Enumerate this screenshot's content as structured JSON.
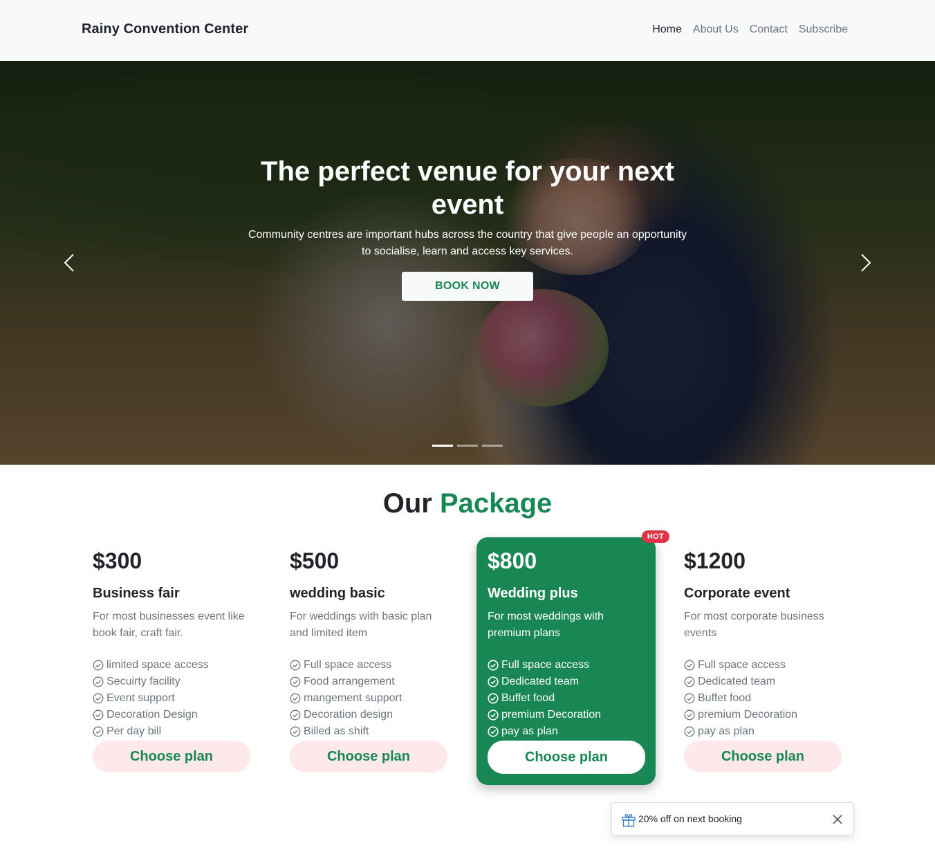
{
  "navbar": {
    "brand": "Rainy Convention Center",
    "links": [
      {
        "label": "Home",
        "active": true
      },
      {
        "label": "About Us",
        "active": false
      },
      {
        "label": "Contact",
        "active": false
      },
      {
        "label": "Subscribe",
        "active": false
      }
    ]
  },
  "hero": {
    "title": "The perfect venue for your next event",
    "text": "Community centres are important hubs across the country that give people an opportunity to socialise, learn and access key services.",
    "cta_label": "BOOK NOW",
    "slides_count": 3,
    "active_slide": 1,
    "prev_icon": "chevron-left-icon",
    "next_icon": "chevron-right-icon"
  },
  "packages": {
    "title_prefix": "Our",
    "title_accent": "Package",
    "accent_color": "#198754",
    "plans": [
      {
        "price": "$300",
        "name": "Business fair",
        "desc": "For most businesses event like book fair, craft fair.",
        "features": [
          "limited space access",
          "Secuirty facility",
          "Event support",
          "Decoration Design",
          "Per day bill"
        ],
        "button": "Choose plan"
      },
      {
        "price": "$500",
        "name": "wedding basic",
        "desc": "For weddings with basic plan and limited item",
        "features": [
          "Full space access",
          "Food arrangement",
          "mangement support",
          "Decoration design",
          "Billed as shift"
        ],
        "button": "Choose plan"
      },
      {
        "price": "$800",
        "name": "Wedding plus",
        "desc": "For most weddings with premium plans",
        "features": [
          "Full space access",
          "Dedicated team",
          "Buffet food",
          "premium Decoration",
          "pay as plan"
        ],
        "button": "Choose plan",
        "badge": "HOT"
      },
      {
        "price": "$1200",
        "name": "Corporate event",
        "desc": "For most corporate business events",
        "features": [
          "Full space access",
          "Dedicated team",
          "Buffet food",
          "premium Decoration",
          "pay as plan"
        ],
        "button": "Choose plan"
      }
    ]
  },
  "toast": {
    "icon": "gift-icon",
    "text": "20% off on next booking",
    "close_icon": "close-icon"
  }
}
